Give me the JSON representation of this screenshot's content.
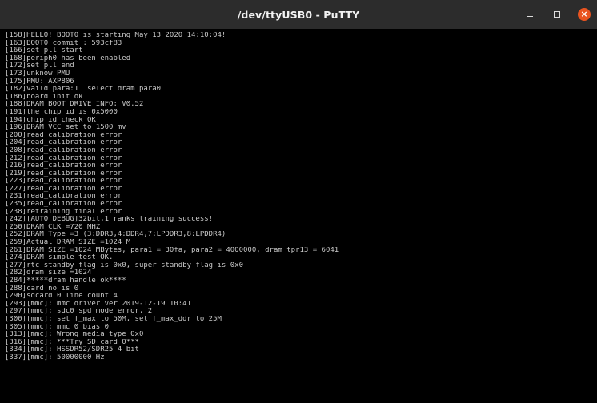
{
  "window": {
    "title": "/dev/ttyUSB0 - PuTTY",
    "close_glyph": "×",
    "colors": {
      "titlebar": "#2c2c2c",
      "terminal_bg": "#000000",
      "terminal_fg": "#c8c8c8",
      "close_button": "#e95420"
    }
  },
  "terminal": {
    "lines": [
      "[158]HELLO! BOOT0 is starting May 13 2020 14:10:04!",
      "[163]BOOT0 commit : 593cf83",
      "[166]set pll start",
      "[168]periph0 has been enabled",
      "[172]set pll end",
      "[173]unknow PMU",
      "[175]PMU: AXP806",
      "[182]vaild para:1  select dram para0",
      "[186]board init ok",
      "[188]DRAM BOOT DRIVE INFO: V0.52",
      "[191]the chip id is 0x5000",
      "[194]chip id check OK",
      "[196]DRAM_VCC set to 1500 mv",
      "[200]read_calibration error",
      "[204]read_calibration error",
      "[208]read_calibration error",
      "[212]read_calibration error",
      "[216]read_calibration error",
      "[219]read_calibration error",
      "[223]read_calibration error",
      "[227]read_calibration error",
      "[231]read_calibration error",
      "[235]read_calibration error",
      "[238]retraining final error",
      "[242][AUTO DEBUG]32bit,1 ranks training success!",
      "[250]DRAM CLK =720 MHZ",
      "[252]DRAM Type =3 (3:DDR3,4:DDR4,7:LPDDR3,8:LPDDR4)",
      "[259]Actual DRAM SIZE =1024 M",
      "[261]DRAM SIZE =1024 MBytes, para1 = 30fa, para2 = 4000000, dram_tpr13 = 6041",
      "[274]DRAM simple test OK.",
      "[277]rtc standby flag is 0x0, super standby flag is 0x0",
      "[282]dram size =1024",
      "[284]*****dram handle ok****",
      "[288]card no is 0",
      "[290]sdcard 0 line count 4",
      "[293][mmc]: mmc driver ver 2019-12-19 10:41",
      "[297][mmc]: sdc0 spd mode error, 2",
      "[300][mmc]: set f_max to 50M, set f_max_ddr to 25M",
      "[305][mmc]: mmc 0 bias 0",
      "[313][mmc]: Wrong media type 0x0",
      "[316][mmc]: ***Try SD card 0***",
      "[334][mmc]: HSSDR52/SDR25 4 bit",
      "[337][mmc]: 50000000 Hz"
    ]
  }
}
